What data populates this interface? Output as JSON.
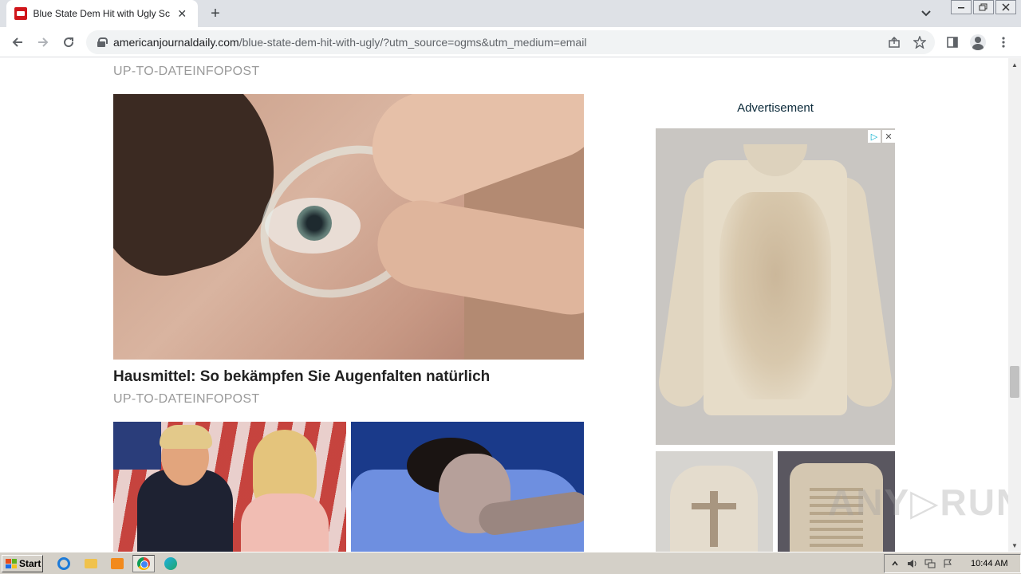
{
  "browser": {
    "tab": {
      "title": "Blue State Dem Hit with Ugly Scanda",
      "close": "✕"
    },
    "new_tab": "+",
    "url": {
      "host": "americanjournaldaily.com",
      "path": "/blue-state-dem-hit-with-ugly/?utm_source=ogms&utm_medium=email"
    }
  },
  "page": {
    "top_source": "UP-TO-DATEINFOPOST",
    "article": {
      "headline": "Hausmittel: So bekämpfen Sie Augenfalten natürlich",
      "source": "UP-TO-DATEINFOPOST"
    },
    "ad": {
      "label": "Advertisement",
      "adchoices_icon": "▷",
      "close_icon": "✕"
    },
    "watermark": "ANY▷RUN"
  },
  "taskbar": {
    "start_label": "Start",
    "clock": "10:44 AM"
  }
}
